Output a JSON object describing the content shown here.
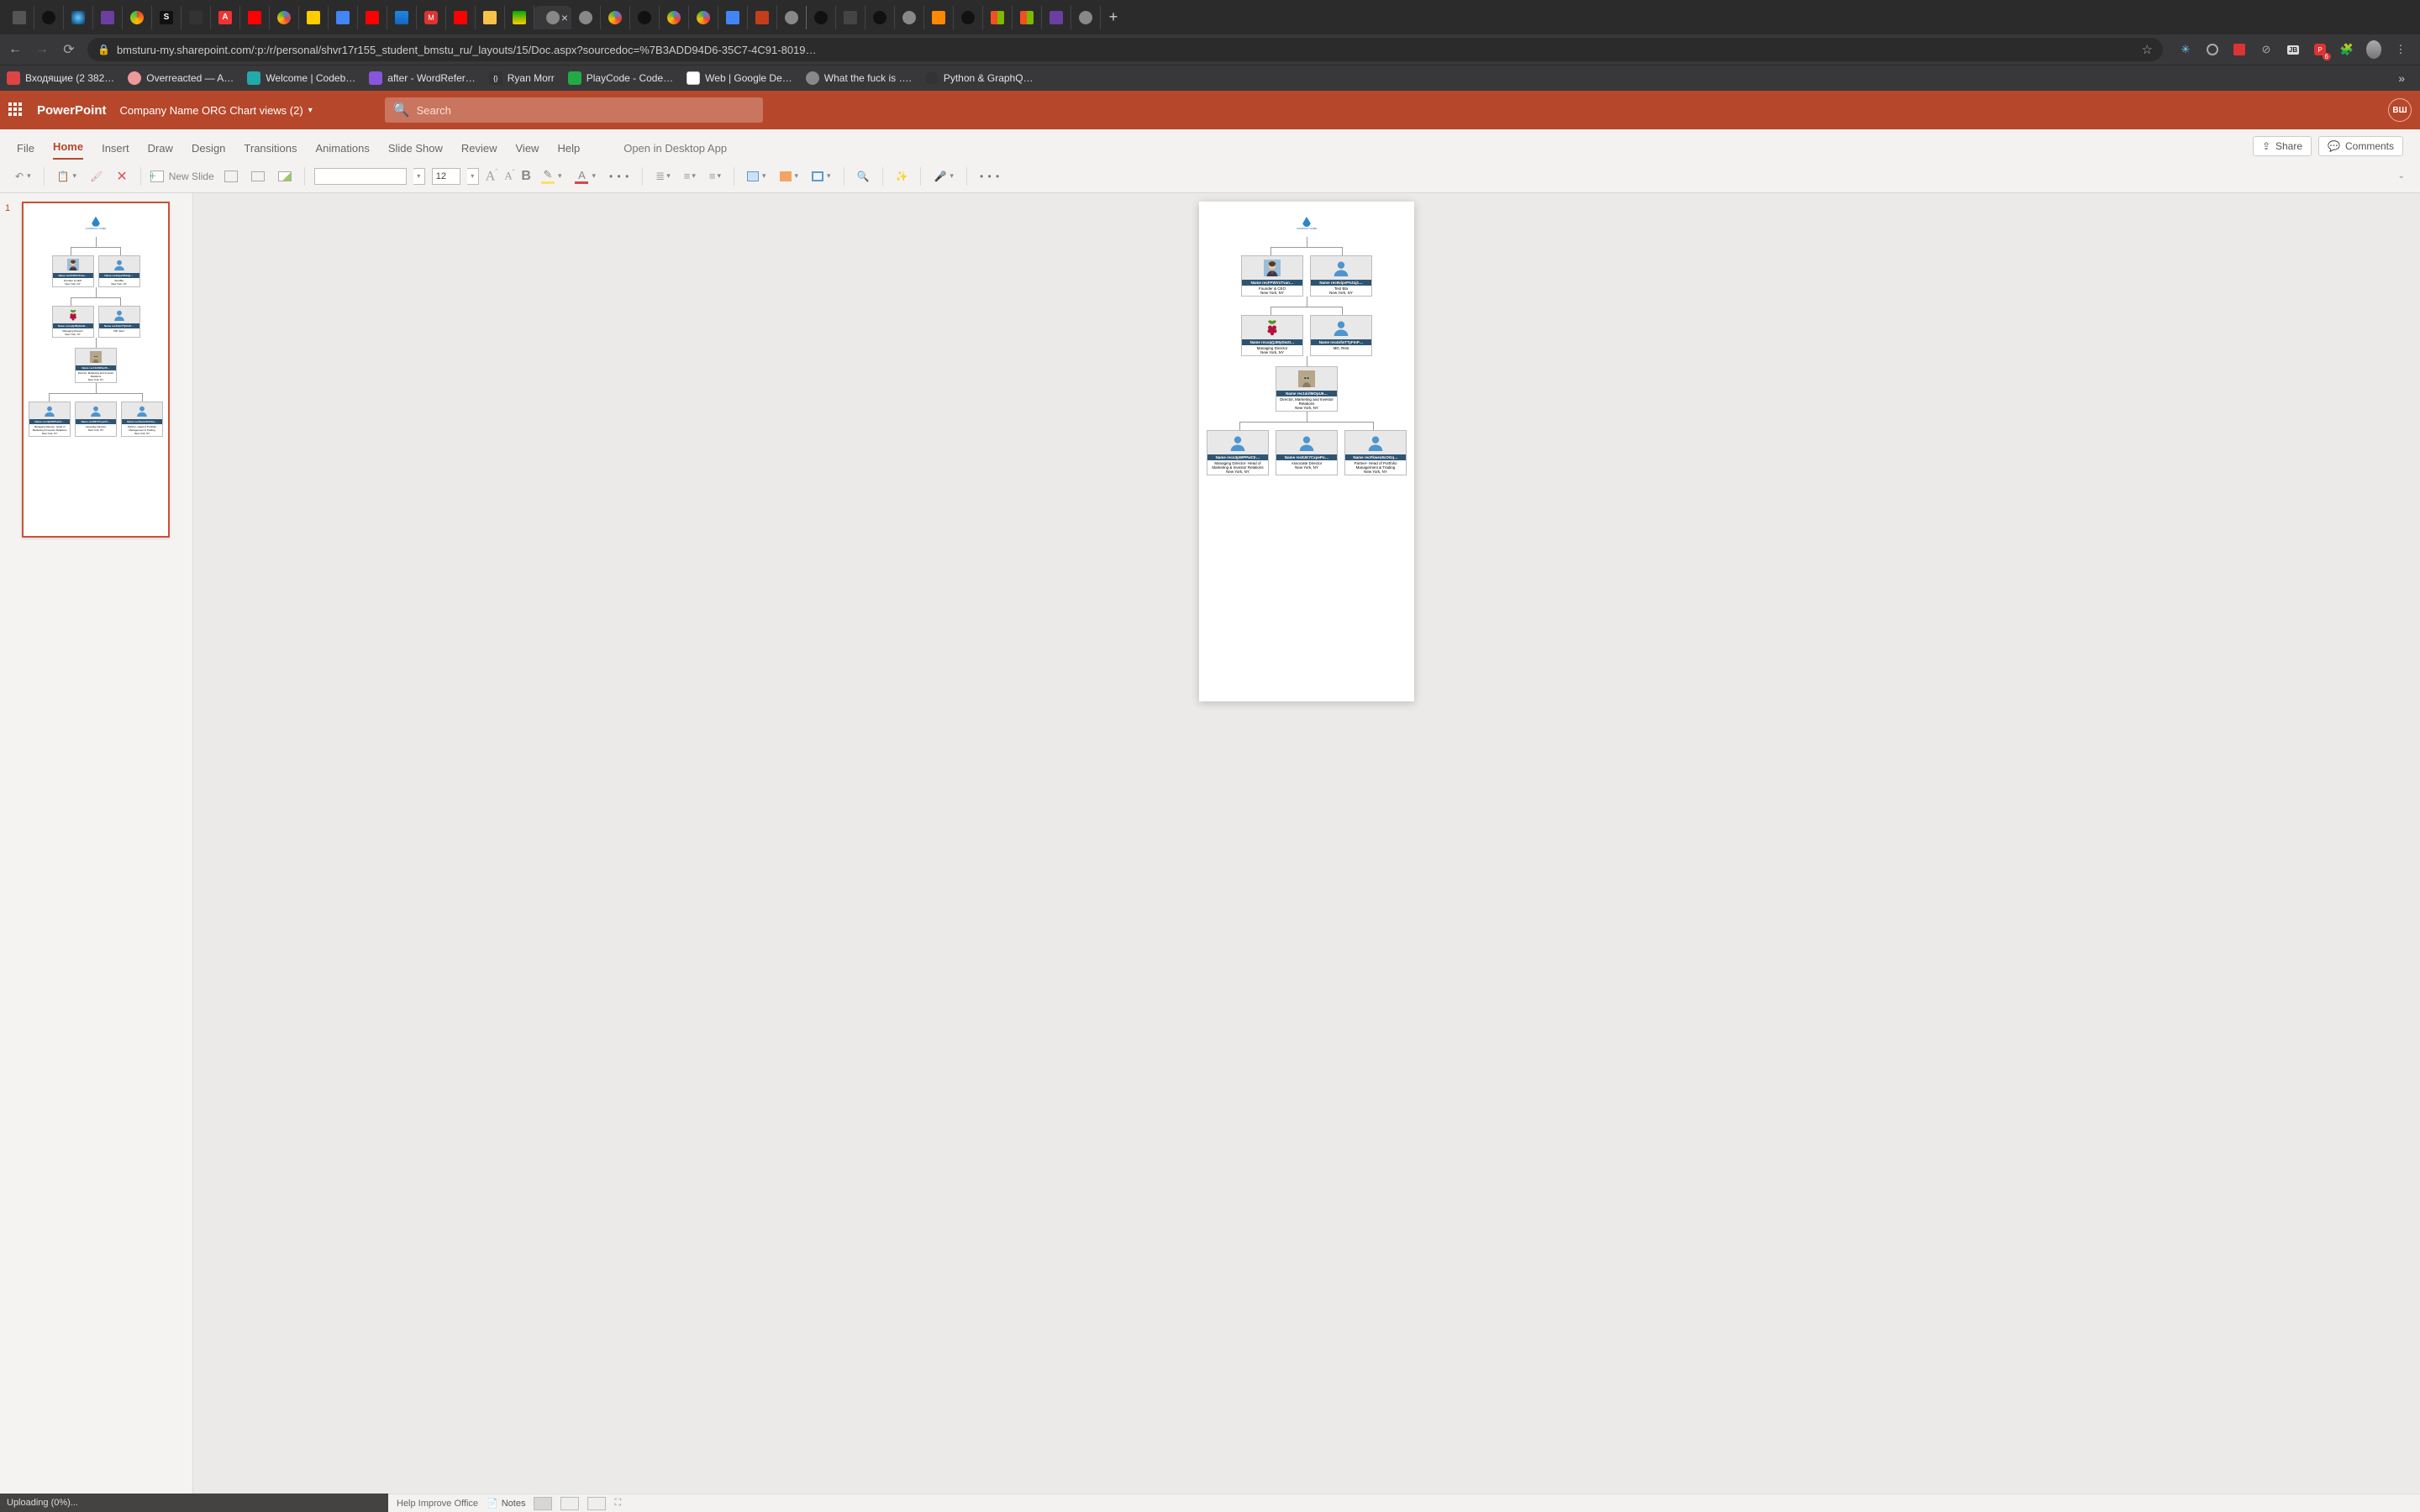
{
  "browser": {
    "url": "bmsturu-my.sharepoint.com/:p:/r/personal/shvr17r155_student_bmstu_ru/_layouts/15/Doc.aspx?sourcedoc=%7B3ADD94D6-35C7-4C91-8019…",
    "new_tab_glyph": "+",
    "ext_badge": "6",
    "bookmarks": [
      {
        "label": "Входящие (2 382…",
        "icon": "bi-red"
      },
      {
        "label": "Overreacted — A…",
        "icon": "bi-pink"
      },
      {
        "label": "Welcome | Codeb…",
        "icon": "bi-teal"
      },
      {
        "label": "after - WordRefer…",
        "icon": "bi-purple"
      },
      {
        "label": "Ryan Morr",
        "icon": "bi-dark"
      },
      {
        "label": "PlayCode - Code…",
        "icon": "bi-green"
      },
      {
        "label": "Web  |  Google De…",
        "icon": "bi-blue"
      },
      {
        "label": "What the fuck is ….",
        "icon": "bi-grey"
      },
      {
        "label": "Python & GraphQ…",
        "icon": "bi-dark"
      }
    ],
    "overflow_glyph": "»"
  },
  "app": {
    "product": "PowerPoint",
    "doc_name": "Company Name ORG Chart views (2)",
    "search_placeholder": "Search",
    "user_initials": "ВШ",
    "tabs": [
      "File",
      "Home",
      "Insert",
      "Draw",
      "Design",
      "Transitions",
      "Animations",
      "Slide Show",
      "Review",
      "View",
      "Help"
    ],
    "active_tab_index": 1,
    "open_desktop": "Open in Desktop App",
    "share_label": "Share",
    "comments_label": "Comments",
    "ribbon": {
      "new_slide": "New Slide",
      "font_size": "12"
    },
    "status_left": "Uploading (0%)...",
    "status_right": {
      "help": "Help Improve Office",
      "notes": "Notes"
    },
    "slide_number": "1"
  },
  "org": {
    "company_tag": "COMPANY NAME",
    "row1": [
      {
        "name": "Name recFFWVnTvan…",
        "role": "Founder & CEO",
        "loc": "New York, NY",
        "img": "avatar-man"
      },
      {
        "name": "Name rec9vipvPAZaj1…",
        "role": "Test Bla",
        "loc": "New York, NY",
        "img": "person"
      }
    ],
    "row2": [
      {
        "name": "Name recxqQJMyDw2I…",
        "role": "Managing Director",
        "loc": "New York, NY",
        "img": "raspberry"
      },
      {
        "name": "Name rec4nfwTTyFmP…",
        "role": "MD, Rest",
        "loc": "",
        "img": "person"
      }
    ],
    "row3": [
      {
        "name": "Name rec14irlMOpU6…",
        "role": "Director, Marketing and Investor Relations",
        "loc": "New York, NY",
        "img": "yoda"
      }
    ],
    "row4": [
      {
        "name": "Name recn3pWPPwCIr…",
        "role": "Managing Director- Head of Marketing & Investor Relations",
        "loc": "New York, NY",
        "img": "person"
      },
      {
        "name": "Name rec8JK7CxpePo…",
        "role": "Associate Director",
        "loc": "New York, NY",
        "img": "person"
      },
      {
        "name": "Name recFkwex8cOGq…",
        "role": "Partner- Head of Portfolio Management & Trading",
        "loc": "New York, NY",
        "img": "person"
      }
    ]
  }
}
